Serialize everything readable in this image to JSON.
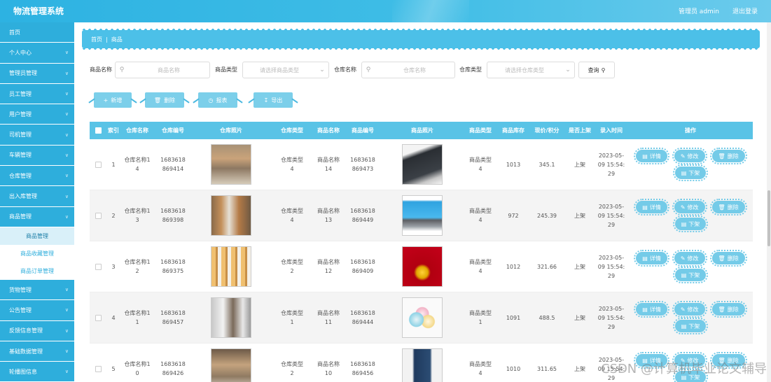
{
  "header": {
    "title": "物流管理系统",
    "user": "管理员 admin",
    "logout": "退出登录"
  },
  "sidebar": {
    "items": [
      {
        "label": "首页",
        "has_chevron": false
      },
      {
        "label": "个人中心",
        "has_chevron": true
      },
      {
        "label": "管理员管理",
        "has_chevron": true
      },
      {
        "label": "员工管理",
        "has_chevron": true
      },
      {
        "label": "用户管理",
        "has_chevron": true
      },
      {
        "label": "司机管理",
        "has_chevron": true
      },
      {
        "label": "车辆管理",
        "has_chevron": true
      },
      {
        "label": "仓库管理",
        "has_chevron": true
      },
      {
        "label": "出入库管理",
        "has_chevron": true
      },
      {
        "label": "商品管理",
        "has_chevron": true
      }
    ],
    "sub_items": [
      {
        "label": "商品管理",
        "active": true
      },
      {
        "label": "商品收藏管理",
        "active": false
      },
      {
        "label": "商品订单管理",
        "active": false
      }
    ],
    "items_after": [
      {
        "label": "货物管理",
        "has_chevron": true
      },
      {
        "label": "公告管理",
        "has_chevron": true
      },
      {
        "label": "反馈信息管理",
        "has_chevron": true
      },
      {
        "label": "基础数据管理",
        "has_chevron": true
      },
      {
        "label": "轮播图信息",
        "has_chevron": true
      }
    ]
  },
  "breadcrumb": {
    "home": "首页",
    "separator": "|",
    "current": "商品"
  },
  "search": {
    "goods_name_label": "商品名称",
    "goods_name_placeholder": "商品名称",
    "goods_type_label": "商品类型",
    "goods_type_placeholder": "请选择商品类型",
    "warehouse_name_label": "仓库名称",
    "warehouse_name_placeholder": "仓库名称",
    "warehouse_type_label": "仓库类型",
    "warehouse_type_placeholder": "请选择仓库类型",
    "query_button": "查询"
  },
  "actions": {
    "add": "新增",
    "delete": "删除",
    "report": "报表",
    "export": "导出"
  },
  "table": {
    "headers": {
      "index": "索引",
      "warehouse_name": "仓库名称",
      "warehouse_code": "仓库编号",
      "warehouse_photo": "仓库照片",
      "warehouse_type": "仓库类型",
      "goods_name": "商品名称",
      "goods_code": "商品编号",
      "goods_photo": "商品照片",
      "goods_type": "商品类型",
      "stock": "商品库存",
      "price": "现价/积分",
      "on_shelf": "是否上架",
      "entry_time": "录入时间",
      "ops": "操作"
    },
    "op_labels": {
      "detail": "详情",
      "edit": "修改",
      "delete": "删除",
      "unshelve": "下架"
    },
    "rows": [
      {
        "index": "1",
        "wn1": "仓库名称1",
        "wn2": "4",
        "wc1": "1683618",
        "wc2": "869414",
        "wphoto": "ph-ware1",
        "wt1": "仓库类型",
        "wt2": "4",
        "gn1": "商品名称",
        "gn2": "14",
        "gc1": "1683618",
        "gc2": "869473",
        "gphoto": "ph-laptop1",
        "gt1": "商品类型",
        "gt2": "4",
        "stock": "1013",
        "price": "345.1",
        "shelf": "上架",
        "t1": "2023-05-",
        "t2": "09 15:54:",
        "t3": "29"
      },
      {
        "index": "2",
        "wn1": "仓库名称1",
        "wn2": "3",
        "wc1": "1683618",
        "wc2": "869398",
        "wphoto": "ph-ware2",
        "wt1": "仓库类型",
        "wt2": "4",
        "gn1": "商品名称",
        "gn2": "13",
        "gc1": "1683618",
        "gc2": "869449",
        "gphoto": "ph-laptop2",
        "gt1": "商品类型",
        "gt2": "4",
        "stock": "972",
        "price": "245.39",
        "shelf": "上架",
        "t1": "2023-05-",
        "t2": "09 15:54:",
        "t3": "29"
      },
      {
        "index": "3",
        "wn1": "仓库名称1",
        "wn2": "2",
        "wc1": "1683618",
        "wc2": "869375",
        "wphoto": "ph-ware3",
        "wt1": "仓库类型",
        "wt2": "2",
        "gn1": "商品名称",
        "gn2": "12",
        "gc1": "1683618",
        "gc2": "869409",
        "gphoto": "ph-neck",
        "gt1": "商品类型",
        "gt2": "4",
        "stock": "1012",
        "price": "321.66",
        "shelf": "上架",
        "t1": "2023-05-",
        "t2": "09 15:54:",
        "t3": "29"
      },
      {
        "index": "4",
        "wn1": "仓库名称1",
        "wn2": "1",
        "wc1": "1683618",
        "wc2": "869457",
        "wphoto": "ph-ware4",
        "wt1": "仓库类型",
        "wt2": "1",
        "gn1": "商品名称",
        "gn2": "11",
        "gc1": "1683618",
        "gc2": "869444",
        "gphoto": "ph-bowls",
        "gt1": "商品类型",
        "gt2": "1",
        "stock": "1091",
        "price": "488.5",
        "shelf": "上架",
        "t1": "2023-05-",
        "t2": "09 15:54:",
        "t3": "29"
      },
      {
        "index": "5",
        "wn1": "仓库名称1",
        "wn2": "0",
        "wc1": "1683618",
        "wc2": "869426",
        "wphoto": "ph-ware5",
        "wt1": "仓库类型",
        "wt2": "2",
        "gn1": "商品名称",
        "gn2": "10",
        "gc1": "1683618",
        "gc2": "869456",
        "gphoto": "ph-man",
        "gt1": "商品类型",
        "gt2": "4",
        "stock": "1010",
        "price": "311.65",
        "shelf": "上架",
        "t1": "2023-05-",
        "t2": "09 15:54:",
        "t3": "29"
      }
    ]
  },
  "watermark": "CSDN @计算机毕业论文辅导"
}
